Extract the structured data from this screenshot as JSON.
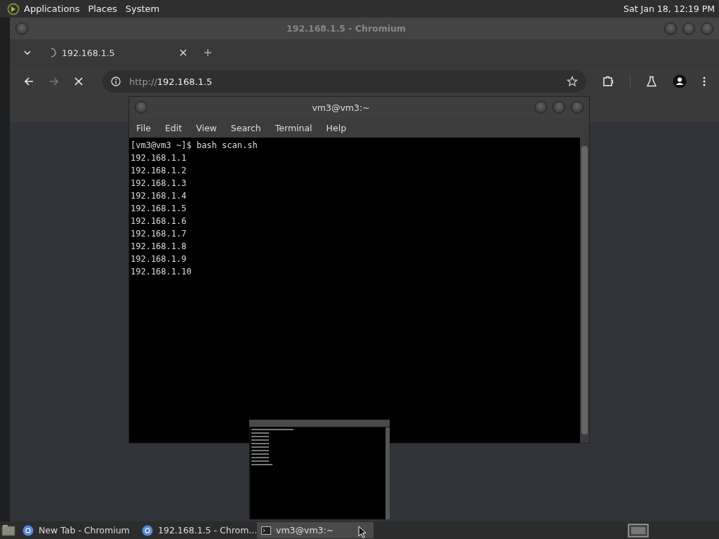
{
  "top_panel": {
    "menus": [
      "Applications",
      "Places",
      "System"
    ],
    "clock": "Sat Jan 18, 12:19 PM"
  },
  "browser": {
    "title": "192.168.1.5 - Chromium",
    "tabs": [
      {
        "label": "192.168.1.5"
      }
    ],
    "address": {
      "scheme": "http://",
      "host": "192.168.1.5"
    }
  },
  "terminal": {
    "title": "vm3@vm3:~",
    "menus": [
      "File",
      "Edit",
      "View",
      "Search",
      "Terminal",
      "Help"
    ],
    "lines": [
      "[vm3@vm3 ~]$ bash scan.sh",
      "192.168.1.1",
      "192.168.1.2",
      "192.168.1.3",
      "192.168.1.4",
      "192.168.1.5",
      "192.168.1.6",
      "192.168.1.7",
      "192.168.1.8",
      "192.168.1.9",
      "192.168.1.10"
    ]
  },
  "taskbar": {
    "items": [
      {
        "label": "New Tab - Chromium",
        "kind": "browser",
        "selected": false
      },
      {
        "label": "192.168.1.5 - Chrom...",
        "kind": "browser",
        "selected": false
      },
      {
        "label": "vm3@vm3:~",
        "kind": "terminal",
        "selected": true
      }
    ]
  }
}
